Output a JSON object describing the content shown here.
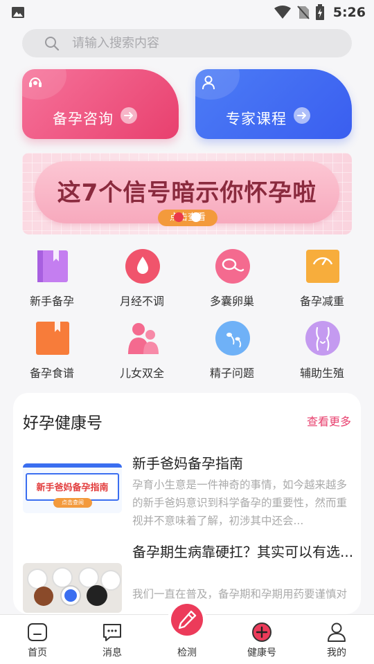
{
  "status_bar": {
    "time": "5:26"
  },
  "search": {
    "placeholder": "请输入搜索内容"
  },
  "cards": [
    {
      "label": "备孕咨询",
      "icon": "headset-icon"
    },
    {
      "label": "专家课程",
      "icon": "person-icon"
    }
  ],
  "banner": {
    "title": "这7个信号暗示你怀孕啦",
    "button": "点击查看"
  },
  "grid": [
    {
      "label": "新手备孕",
      "icon": "book-icon",
      "color": "#c47ef0"
    },
    {
      "label": "月经不调",
      "icon": "drop-icon",
      "color": "#f0546c"
    },
    {
      "label": "多囊卵巢",
      "icon": "ovary-icon",
      "color": "#f46a8f"
    },
    {
      "label": "备孕减重",
      "icon": "scale-icon",
      "color": "#f7ad3c"
    },
    {
      "label": "备孕食谱",
      "icon": "recipe-icon",
      "color": "#f77c3a"
    },
    {
      "label": "儿女双全",
      "icon": "family-icon",
      "color": "#f46a8f"
    },
    {
      "label": "精子问题",
      "icon": "sperm-icon",
      "color": "#6fb1f7"
    },
    {
      "label": "辅助生殖",
      "icon": "body-icon",
      "color": "#c49af0"
    }
  ],
  "health": {
    "title": "好孕健康号",
    "more": "查看更多",
    "articles": [
      {
        "title": "新手爸妈备孕指南",
        "desc": "孕育小生意是一件神奇的事情，如今越来越多的新手爸妈意识到科学备孕的重要性，然而重视并不意味着了解，初涉其中还会...",
        "thumb_title": "新手爸妈备孕指南",
        "thumb_button": "点击查阅"
      },
      {
        "title": "备孕期生病靠硬扛？其实可以有选...",
        "desc": "我们一直在普及，备孕期和孕期用药要谨慎对"
      }
    ]
  },
  "nav": [
    {
      "label": "首页",
      "icon": "home-icon"
    },
    {
      "label": "消息",
      "icon": "message-icon"
    },
    {
      "label": "检测",
      "icon": "pen-icon"
    },
    {
      "label": "健康号",
      "icon": "plus-circle-icon"
    },
    {
      "label": "我的",
      "icon": "profile-icon"
    }
  ],
  "colors": {
    "accent": "#e8406e",
    "blue": "#3a5ef0",
    "detect": "#ec3b5a"
  }
}
